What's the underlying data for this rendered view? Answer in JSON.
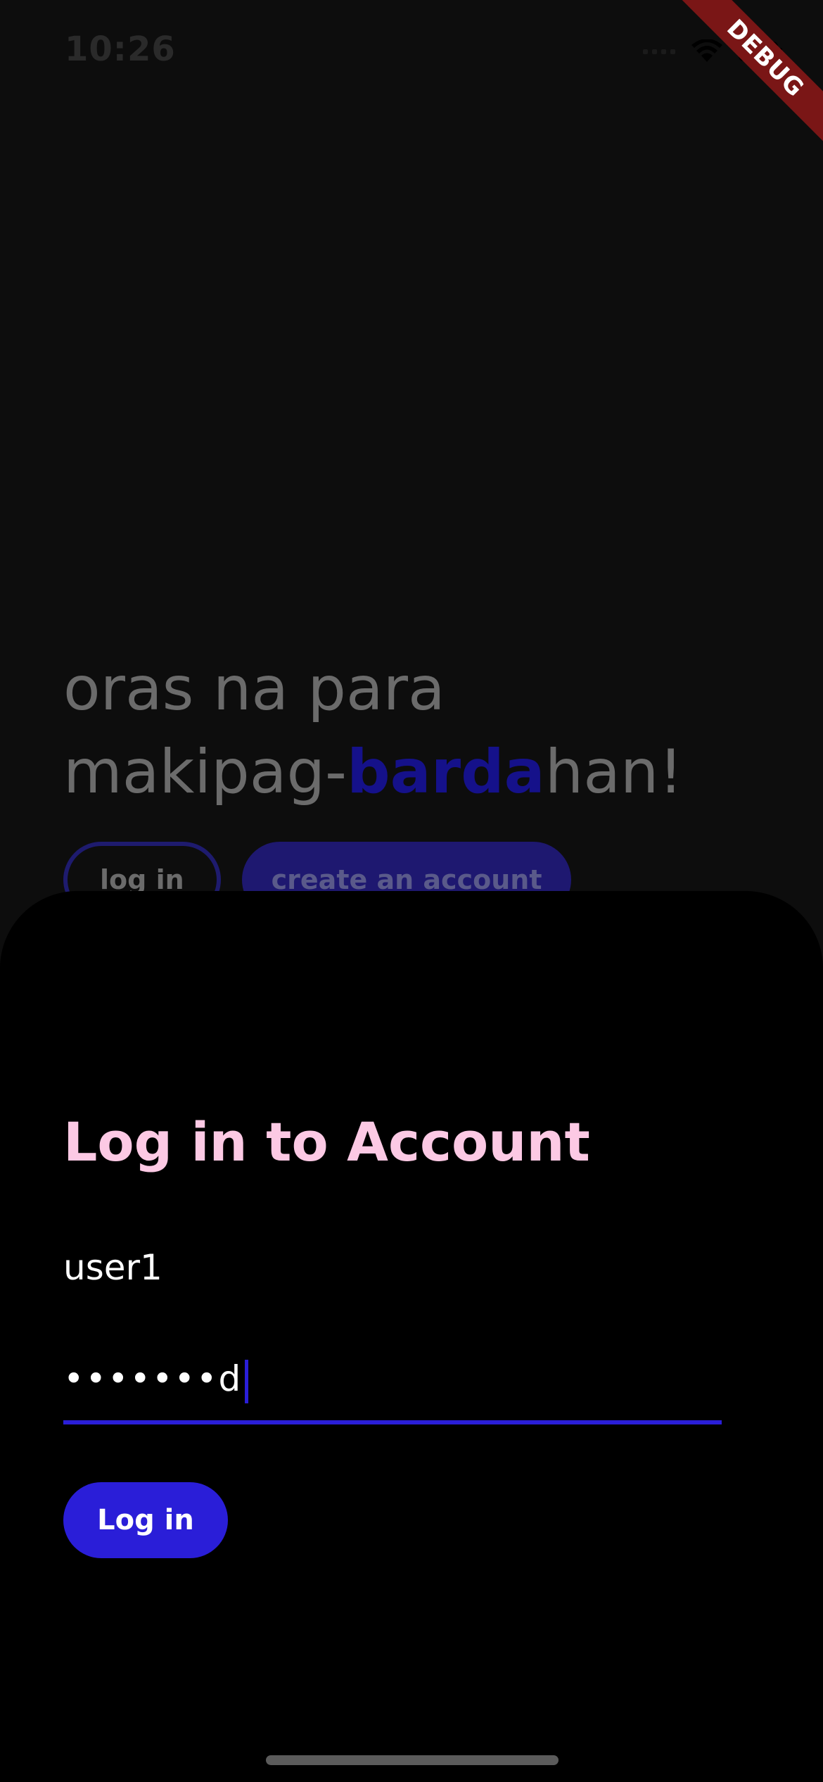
{
  "status_bar": {
    "time": "10:26"
  },
  "debug_banner": "DEBUG",
  "headline": {
    "line1": "oras na para",
    "prefix": "makipag-",
    "accent": "barda",
    "suffix": "han!"
  },
  "background_buttons": {
    "login": "log in",
    "create": "create an account"
  },
  "login_sheet": {
    "title": "Log in to Account",
    "username_value": "user1",
    "password_value": "•••••••d",
    "submit_label": "Log in"
  },
  "colors": {
    "accent": "#2a1ed8",
    "title": "#fcc9e4",
    "headline_accent": "#15118a"
  }
}
